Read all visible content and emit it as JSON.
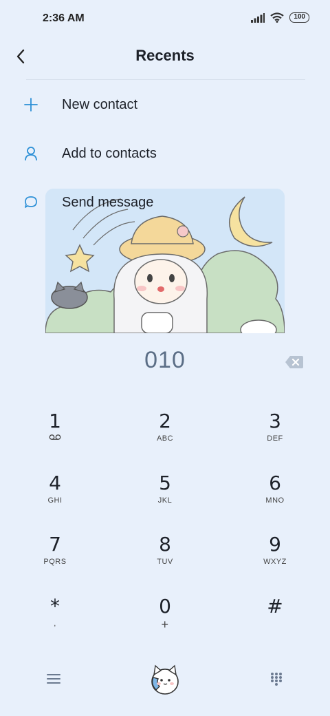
{
  "status_bar": {
    "time": "2:36 AM",
    "battery": "100",
    "icons": [
      "signal-icon",
      "wifi-icon",
      "battery-icon"
    ]
  },
  "header": {
    "title": "Recents",
    "back_icon": "back-arrow-icon"
  },
  "actions": [
    {
      "label": "New contact",
      "icon": "plus-icon"
    },
    {
      "label": "Add to contacts",
      "icon": "person-icon"
    },
    {
      "label": "Send message",
      "icon": "message-icon"
    }
  ],
  "banner": {
    "description_icon": "theme-illustration"
  },
  "dialer": {
    "number": "010",
    "backspace_icon": "backspace-icon"
  },
  "keypad": [
    {
      "digit": "1",
      "letters": ""
    },
    {
      "digit": "2",
      "letters": "ABC"
    },
    {
      "digit": "3",
      "letters": "DEF"
    },
    {
      "digit": "4",
      "letters": "GHI"
    },
    {
      "digit": "5",
      "letters": "JKL"
    },
    {
      "digit": "6",
      "letters": "MNO"
    },
    {
      "digit": "7",
      "letters": "PQRS"
    },
    {
      "digit": "8",
      "letters": "TUV"
    },
    {
      "digit": "9",
      "letters": "WXYZ"
    },
    {
      "digit": "*",
      "letters": ","
    },
    {
      "digit": "0",
      "letters": "+"
    },
    {
      "digit": "#",
      "letters": ""
    }
  ],
  "bottom_bar": {
    "menu_icon": "menu-icon",
    "call_icon": "call-mascot-icon",
    "dialpad_icon": "dialpad-icon"
  },
  "colors": {
    "background": "#e8f0fb",
    "accent": "#2b8fd6",
    "number": "#5b6e86"
  }
}
